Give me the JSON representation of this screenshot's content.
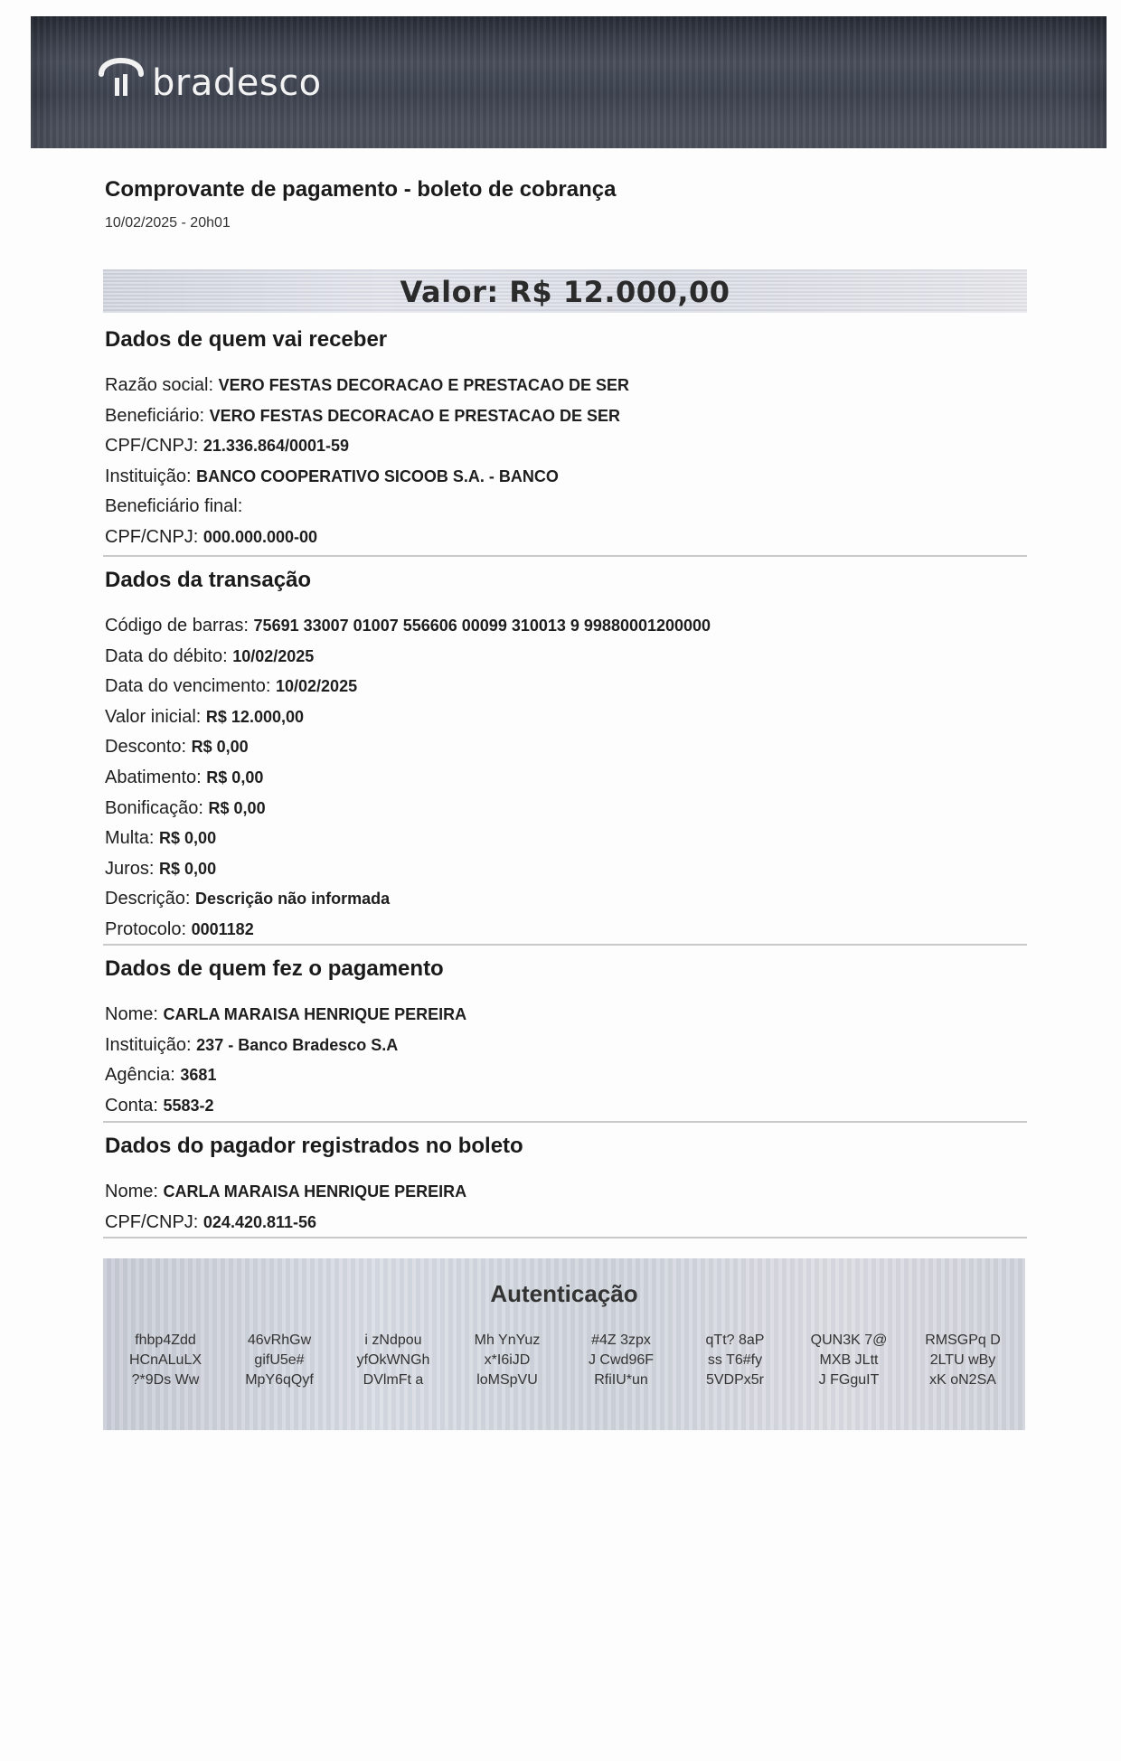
{
  "brand": {
    "name": "bradesco"
  },
  "document": {
    "title": "Comprovante de pagamento - boleto de cobrança",
    "datetime": "10/02/2025 - 20h01",
    "value": "Valor: R$ 12.000,00"
  },
  "receiver": {
    "title": "Dados de quem vai receber",
    "rows": [
      {
        "label": "Razão social:",
        "value": "VERO FESTAS DECORACAO E PRESTACAO DE SER"
      },
      {
        "label": "Beneficiário:",
        "value": "VERO FESTAS DECORACAO E PRESTACAO DE SER"
      },
      {
        "label": "CPF/CNPJ:",
        "value": "21.336.864/0001-59"
      },
      {
        "label": "Instituição:",
        "value": "BANCO COOPERATIVO SICOOB S.A. - BANCO"
      },
      {
        "label": "Beneficiário final:",
        "value": ""
      },
      {
        "label": "CPF/CNPJ:",
        "value": "000.000.000-00"
      }
    ]
  },
  "transaction": {
    "title": "Dados da transação",
    "rows": [
      {
        "label": "Código de barras:",
        "value": "75691 33007 01007 556606 00099 310013 9 99880001200000"
      },
      {
        "label": "Data do débito:",
        "value": "10/02/2025"
      },
      {
        "label": "Data do vencimento:",
        "value": "10/02/2025"
      },
      {
        "label": "Valor inicial:",
        "value": "R$ 12.000,00"
      },
      {
        "label": "Desconto:",
        "value": "R$ 0,00"
      },
      {
        "label": "Abatimento:",
        "value": "R$ 0,00"
      },
      {
        "label": "Bonificação:",
        "value": "R$ 0,00"
      },
      {
        "label": "Multa:",
        "value": "R$ 0,00"
      },
      {
        "label": "Juros:",
        "value": "R$ 0,00"
      },
      {
        "label": "Descrição:",
        "value": "Descrição não informada"
      },
      {
        "label": "Protocolo:",
        "value": "0001182"
      }
    ]
  },
  "payer": {
    "title": "Dados de quem fez o pagamento",
    "rows": [
      {
        "label": "Nome:",
        "value": "CARLA MARAISA HENRIQUE PEREIRA"
      },
      {
        "label": "Instituição:",
        "value": "237 - Banco Bradesco S.A"
      },
      {
        "label": "Agência:",
        "value": "3681"
      },
      {
        "label": "Conta:",
        "value": "5583-2"
      }
    ]
  },
  "boleto_payer": {
    "title": "Dados do pagador registrados no boleto",
    "rows": [
      {
        "label": "Nome:",
        "value": "CARLA MARAISA HENRIQUE PEREIRA"
      },
      {
        "label": "CPF/CNPJ:",
        "value": "024.420.811-56"
      }
    ]
  },
  "authentication": {
    "title": "Autenticação",
    "columns": [
      [
        "fhbp4Zdd",
        "HCnALuLX",
        "?*9Ds Ww"
      ],
      [
        "46vRhGw",
        "gifU5e#",
        "MpY6qQyf"
      ],
      [
        "i zNdpou",
        "yfOkWNGh",
        "DVlmFt a"
      ],
      [
        "Mh YnYuz",
        "x*I6iJD",
        "loMSpVU"
      ],
      [
        "#4Z 3zpx",
        "J Cwd96F",
        "RfiIU*un"
      ],
      [
        "qTt? 8aP",
        "ss T6#fy",
        "5VDPx5r"
      ],
      [
        "QUN3K 7@",
        "MXB JLtt",
        "J FGguIT"
      ],
      [
        "RMSGPq D",
        "2LTU wBy",
        "xK oN2SA"
      ]
    ]
  },
  "colors": {
    "header": "#3e4350",
    "text": "#1a1a1a",
    "divider": "#c9c9c9"
  }
}
